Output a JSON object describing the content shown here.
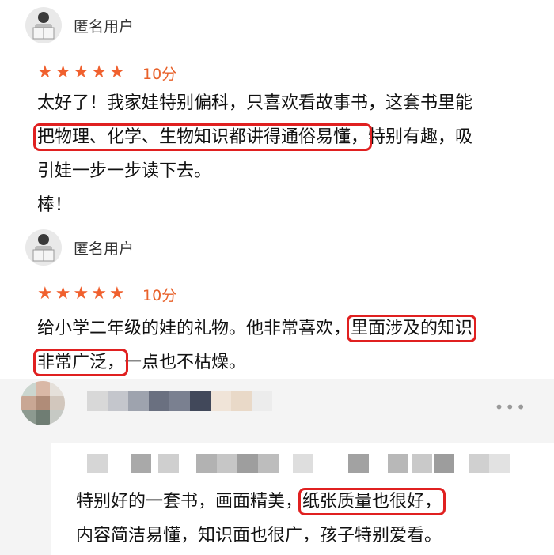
{
  "reviews": [
    {
      "username": "匿名用户",
      "rating": 5,
      "score": "10分",
      "lines": [
        [
          {
            "t": "太好了！我家娃特别偏科，只喜欢看故事书，这套书里能",
            "hl": false
          }
        ],
        [
          {
            "t": "把物理、化学、生物知识都讲得通俗易懂，",
            "hl": true
          },
          {
            "t": "特别有趣，吸",
            "hl": false
          }
        ],
        [
          {
            "t": "引娃一步一步读下去。",
            "hl": false
          }
        ],
        [
          {
            "t": "棒！",
            "hl": false
          }
        ]
      ]
    },
    {
      "username": "匿名用户",
      "rating": 5,
      "score": "10分",
      "lines": [
        [
          {
            "t": "给小学二年级的娃的礼物。他非常喜欢，",
            "hl": false
          },
          {
            "t": "里面涉及的知识",
            "hl": true
          }
        ],
        [
          {
            "t": "非常广泛，",
            "hl": true
          },
          {
            "t": "一点也不枯燥。",
            "hl": false
          }
        ]
      ]
    }
  ],
  "comment": {
    "more_icon": "•••",
    "lines": [
      [
        {
          "t": "特别好的一套书，画面精美，",
          "hl": false
        },
        {
          "t": "纸张质量也很好，",
          "hl": true
        }
      ],
      [
        {
          "t": "内容简洁易懂，知识面也很广，孩子特别爱看。",
          "hl": false
        }
      ]
    ]
  },
  "colors": {
    "star": "#f0602e",
    "score": "#e8612a",
    "highlight": "#e02020"
  }
}
